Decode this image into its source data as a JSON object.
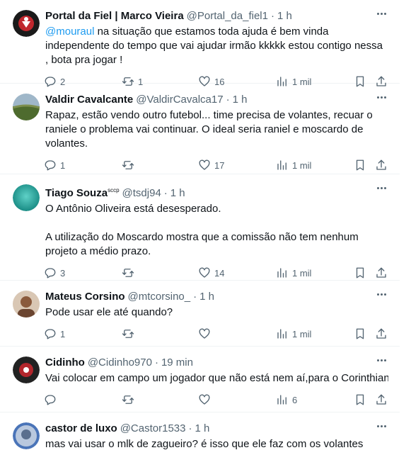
{
  "tweets": [
    {
      "name": "Portal da Fiel | Marco Vieira",
      "handle": "@Portal_da_fiel1",
      "time": "1 h",
      "mention": "@mouraul",
      "text": " na situação que estamos toda ajuda é bem vinda independente do tempo que vai ajudar irmão kkkkk  estou contigo nessa , bota pra jogar !",
      "replies": "2",
      "retweets": "1",
      "likes": "16",
      "views": "1 mil"
    },
    {
      "name": "Valdir Cavalcante",
      "handle": "@ValdirCavalca17",
      "time": "1 h",
      "text": "Rapaz, estão vendo outro futebol... time precisa de volantes, recuar o raniele o problema vai continuar. O ideal seria raniel e moscardo de volantes.",
      "replies": "1",
      "retweets": "",
      "likes": "17",
      "views": "1 mil"
    },
    {
      "name": "Tiago Souza",
      "name_sup": "sccp",
      "handle": "@tsdj94",
      "time": "1 h",
      "text": "O Antônio Oliveira está desesperado.\n\nA utilização do Moscardo mostra que a comissão não tem nenhum projeto a médio prazo.",
      "replies": "3",
      "retweets": "",
      "likes": "14",
      "views": "1 mil"
    },
    {
      "name": "Mateus Corsino",
      "handle": "@mtcorsino_",
      "time": "1 h",
      "text": "Pode usar ele até quando?",
      "replies": "1",
      "retweets": "",
      "likes": "",
      "views": "1 mil"
    },
    {
      "name": "Cidinho",
      "handle": "@Cidinho970",
      "time": "19 min",
      "text": "Vai colocar em campo um jogador que não está nem aí,para o Corinthians...",
      "replies": "",
      "retweets": "",
      "likes": "",
      "views": "6"
    },
    {
      "name": "castor de luxo",
      "handle": "@Castor1533",
      "time": "1 h",
      "text": "mas vai usar o mlk de zagueiro? é isso que ele faz com os volantes"
    }
  ],
  "separator": "·",
  "icons": [
    "reply-icon",
    "retweet-icon",
    "like-icon",
    "views-icon",
    "bookmark-icon",
    "share-icon",
    "more-icon"
  ]
}
